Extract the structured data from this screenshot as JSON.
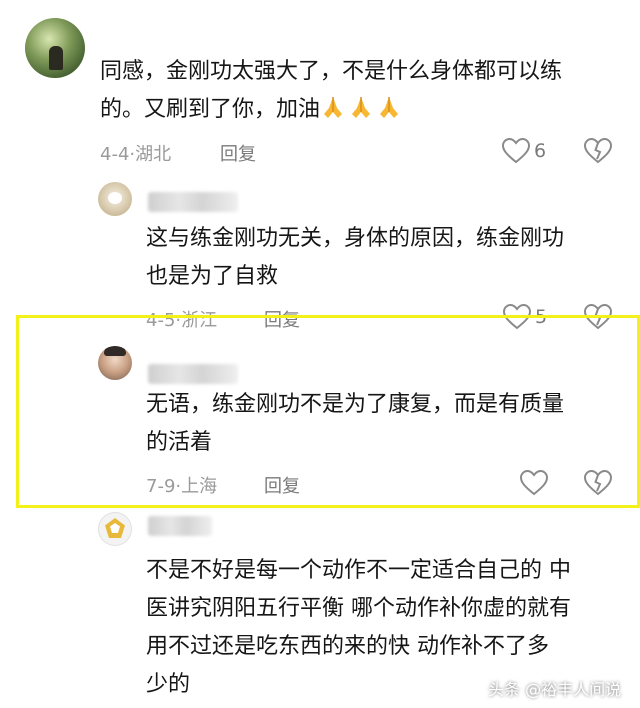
{
  "comments": [
    {
      "text_line1": "同感，金刚功太强大了，不是什么身体都可以练",
      "text_line2": "的。又刷到了你，加油",
      "emoji": "pray-hands",
      "date": "4-4",
      "location": "湖北",
      "reply_label": "回复",
      "like_count": "6"
    },
    {
      "text_line1": "这与练金刚功无关，身体的原因，练金刚功",
      "text_line2": "也是为了自救",
      "date": "4-5",
      "location": "浙江",
      "reply_label": "回复",
      "like_count": "5"
    },
    {
      "text_line1": "无语，练金刚功不是为了康复，而是有质量",
      "text_line2": "的活着",
      "date": "7-9",
      "location": "上海",
      "reply_label": "回复",
      "like_count": ""
    },
    {
      "text_line1": "不是不好是每一个动作不一定适合自己的 中",
      "text_line2": "医讲究阴阳五行平衡 哪个动作补你虚的就有",
      "text_line3": "用不过还是吃东西的来的快  动作补不了多",
      "text_line4": "少的"
    }
  ],
  "separator": "·",
  "watermark": "头条 @裕丰人间说",
  "colors": {
    "highlight": "#f2f21a",
    "meta": "#9a9a9a",
    "text": "#161616"
  }
}
